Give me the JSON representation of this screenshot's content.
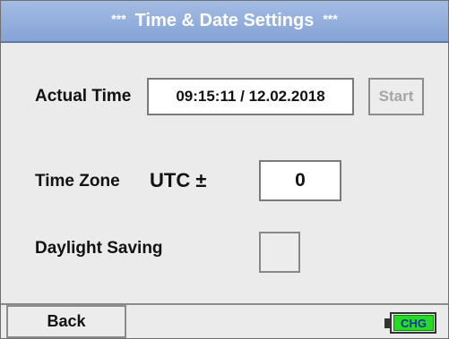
{
  "title": {
    "stars_left": "***",
    "text": "Time & Date Settings",
    "stars_right": "***"
  },
  "actual_time": {
    "label": "Actual Time",
    "value": "09:15:11 / 12.02.2018",
    "start_label": "Start"
  },
  "time_zone": {
    "label": "Time Zone",
    "utc_label": "UTC ±",
    "value": "0"
  },
  "daylight_saving": {
    "label": "Daylight Saving",
    "checked": false
  },
  "footer": {
    "back_label": "Back",
    "battery_label": "CHG"
  },
  "colors": {
    "title_bar": "#94aedd",
    "battery_fill": "#22dd22",
    "battery_text": "#1a2d9e",
    "disabled_text": "#a5a5a5"
  }
}
